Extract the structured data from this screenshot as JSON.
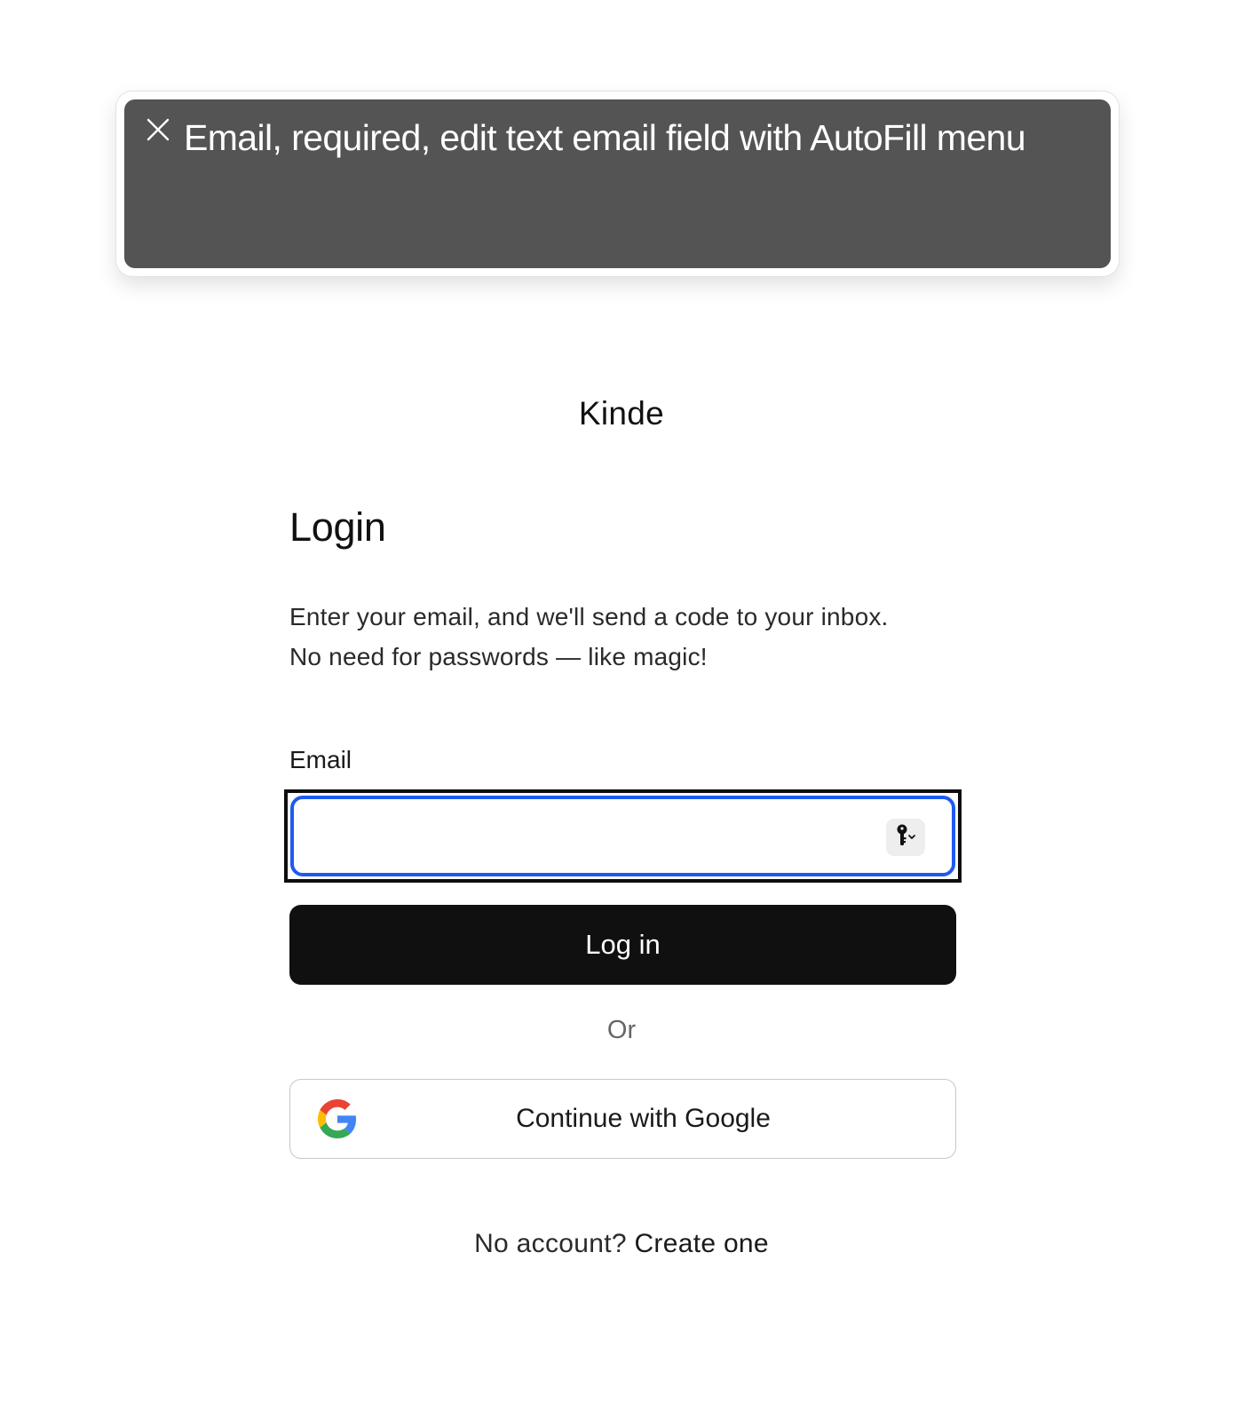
{
  "voiceover_caption": {
    "text": "Email, required, edit text email field with AutoFill menu",
    "close_icon": "close-icon",
    "background_color": "#545454"
  },
  "brand": {
    "name": "Kinde"
  },
  "login": {
    "title": "Login",
    "description_line1": "Enter your email, and we'll send a code to your inbox.",
    "description_line2": "No need for passwords — like magic!",
    "email_label": "Email",
    "email_value": "",
    "email_placeholder": "",
    "autofill_icon": "key-icon",
    "submit_label": "Log in",
    "divider_label": "Or",
    "google_label": "Continue with Google",
    "google_icon": "google-logo-icon",
    "signup_prompt": "No account?",
    "signup_link": "Create one"
  },
  "colors": {
    "focus_blue": "#1f5af0",
    "primary_button": "#101010",
    "google_red": "#EA4335",
    "google_yellow": "#FBBC05",
    "google_green": "#34A853",
    "google_blue": "#4285F4"
  }
}
